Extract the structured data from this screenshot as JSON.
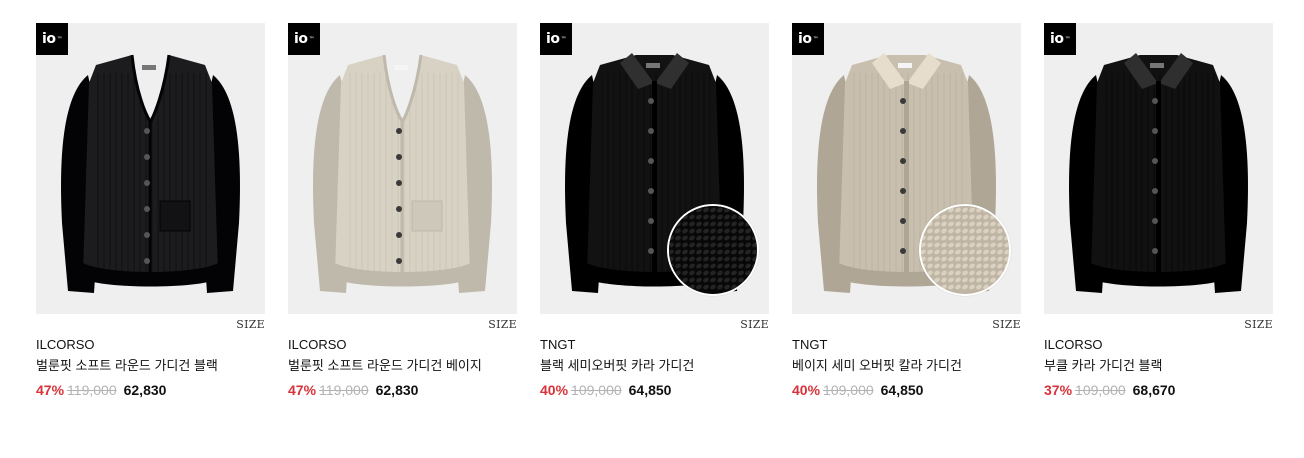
{
  "badge": {
    "text": "io",
    "mark": "™"
  },
  "size_label": "SIZE",
  "products": [
    {
      "brand": "ILCORSO",
      "name": "벌룬핏 소프트 라운드 가디건 블랙",
      "discount": "47%",
      "original_price": "119,000",
      "price": "62,830",
      "color": "#1c1c1f",
      "style": "round",
      "has_swatch": false
    },
    {
      "brand": "ILCORSO",
      "name": "벌룬핏 소프트 라운드 가디건 베이지",
      "discount": "47%",
      "original_price": "119,000",
      "price": "62,830",
      "color": "#d8d2c4",
      "style": "round",
      "has_swatch": false
    },
    {
      "brand": "TNGT",
      "name": "블랙 세미오버핏 카라 가디건",
      "discount": "40%",
      "original_price": "109,000",
      "price": "64,850",
      "color": "#121212",
      "style": "collar",
      "has_swatch": true
    },
    {
      "brand": "TNGT",
      "name": "베이지 세미 오버핏 칼라 가디건",
      "discount": "40%",
      "original_price": "109,000",
      "price": "64,850",
      "color": "#c9bfae",
      "style": "collar",
      "has_swatch": true
    },
    {
      "brand": "ILCORSO",
      "name": "부클 카라 가디건 블랙",
      "discount": "37%",
      "original_price": "109,000",
      "price": "68,670",
      "color": "#111111",
      "style": "collar",
      "has_swatch": false
    }
  ]
}
